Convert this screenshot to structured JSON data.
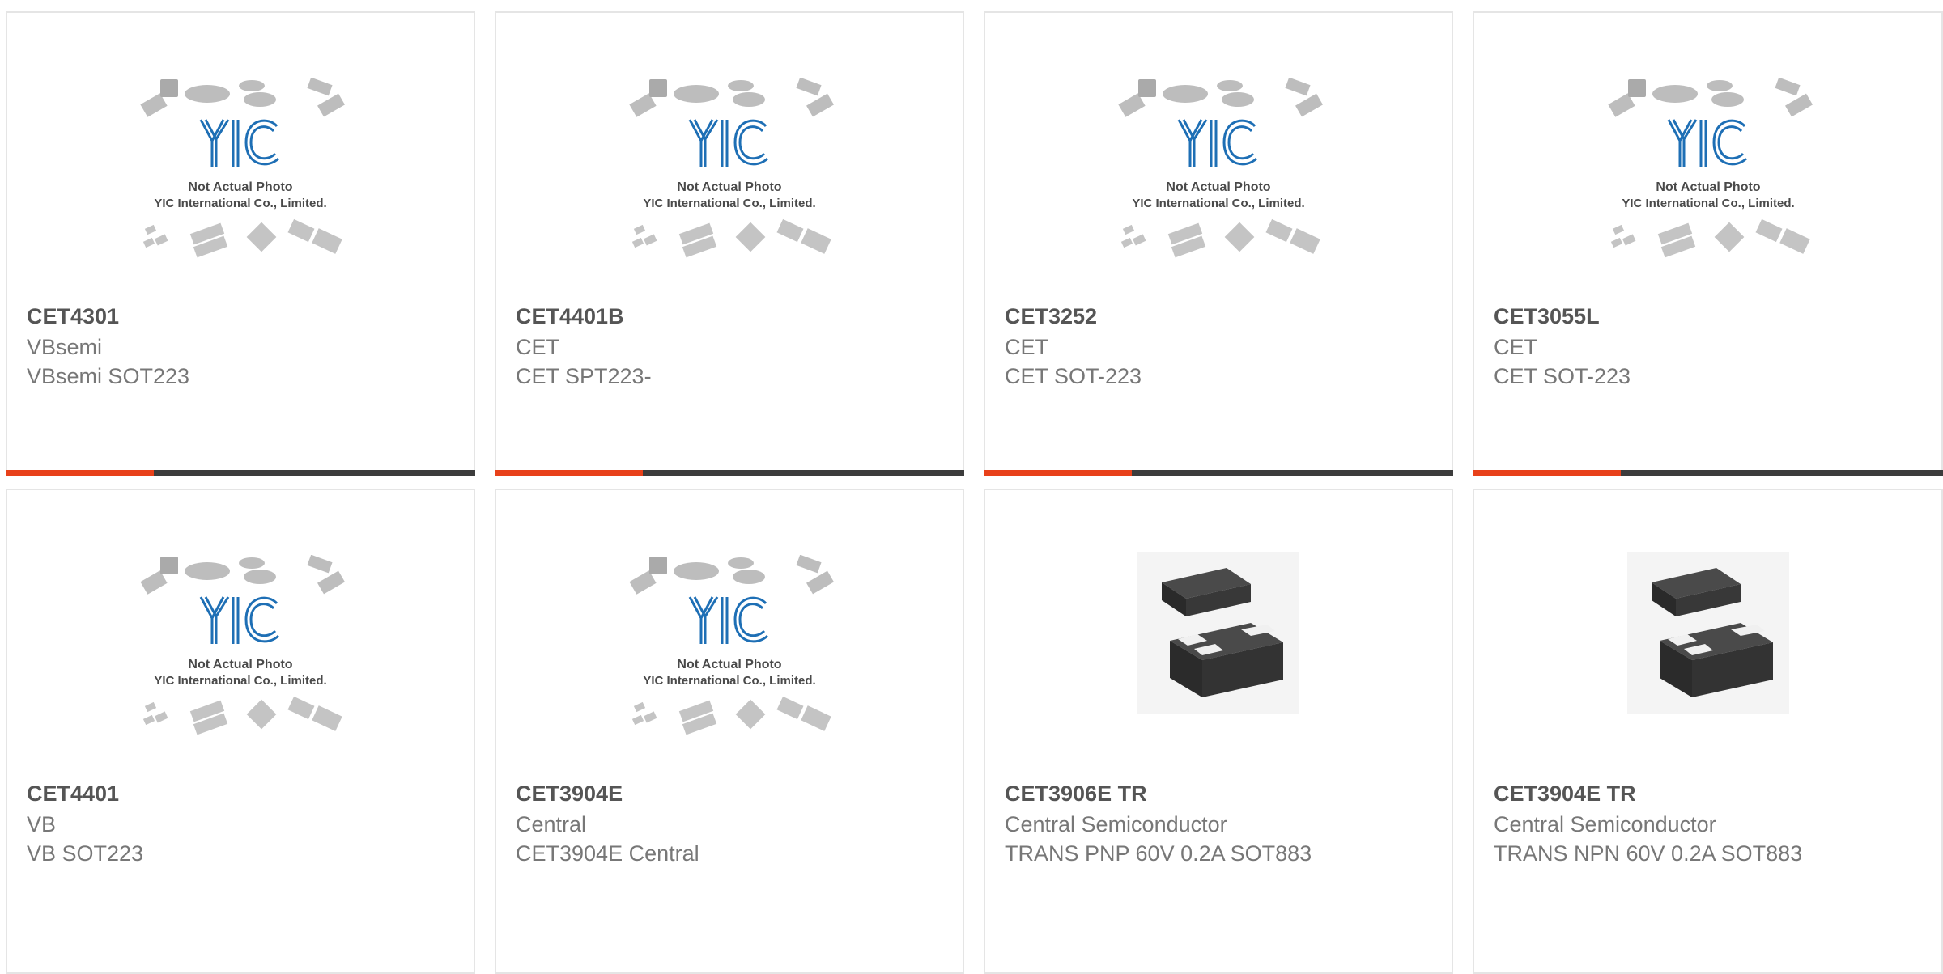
{
  "theme": {
    "accent_color": "#e8411a",
    "bar_color": "#3c3c3c",
    "logo_color": "#1e6fb5",
    "package_color": "#bdbdbd"
  },
  "placeholder": {
    "logo_text": "YIC",
    "line1": "Not Actual Photo",
    "line2": "YIC International Co., Limited."
  },
  "products": [
    {
      "part": "CET4301",
      "manufacturer": "VBsemi",
      "description": "VBsemi SOT223",
      "image": "placeholder-logo",
      "progress": 0.32
    },
    {
      "part": "CET4401B",
      "manufacturer": "CET",
      "description": "CET SPT223-",
      "image": "placeholder-logo",
      "progress": 0.32
    },
    {
      "part": "CET3252",
      "manufacturer": "CET",
      "description": "CET SOT-223",
      "image": "placeholder-logo",
      "progress": 0.32
    },
    {
      "part": "CET3055L",
      "manufacturer": "CET",
      "description": "CET SOT-223",
      "image": "placeholder-logo",
      "progress": 0.32
    },
    {
      "part": "CET4401",
      "manufacturer": "VB",
      "description": "VB SOT223",
      "image": "placeholder-logo"
    },
    {
      "part": "CET3904E",
      "manufacturer": "Central",
      "description": "CET3904E Central",
      "image": "placeholder-logo"
    },
    {
      "part": "CET3906E TR",
      "manufacturer": "Central Semiconductor",
      "description": "TRANS PNP 60V 0.2A SOT883",
      "image": "sot883-package"
    },
    {
      "part": "CET3904E TR",
      "manufacturer": "Central Semiconductor",
      "description": "TRANS NPN 60V 0.2A SOT883",
      "image": "sot883-package"
    }
  ]
}
